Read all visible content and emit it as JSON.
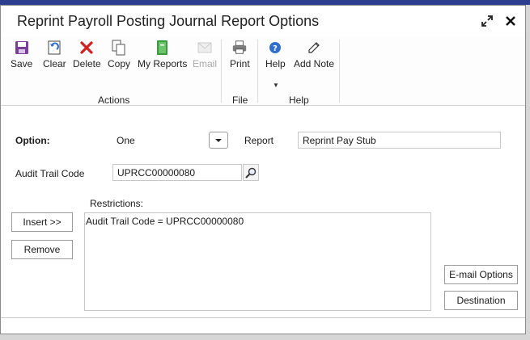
{
  "window": {
    "title": "Reprint Payroll Posting Journal Report Options"
  },
  "ribbon": {
    "actions": {
      "group_label": "Actions",
      "save": "Save",
      "clear": "Clear",
      "delete": "Delete",
      "copy": "Copy",
      "my_reports": "My Reports",
      "email": "Email"
    },
    "file": {
      "group_label": "File",
      "print": "Print"
    },
    "help": {
      "group_label": "Help",
      "help": "Help",
      "add_note": "Add Note"
    }
  },
  "form": {
    "option_label": "Option:",
    "option_value": "One",
    "report_label": "Report",
    "report_value": "Reprint Pay Stub",
    "audit_trail_label": "Audit Trail Code",
    "audit_trail_value": "UPRCC00000080",
    "restrictions_label": "Restrictions:",
    "restrictions": [
      "Audit Trail Code = UPRCC00000080"
    ]
  },
  "buttons": {
    "insert": "Insert >>",
    "remove": "Remove",
    "email_options": "E-mail Options",
    "destination": "Destination"
  },
  "icons": {
    "save": "floppy-disk-icon",
    "clear": "undo-icon",
    "delete": "red-x-icon",
    "copy": "copy-pages-icon",
    "my_reports": "green-book-icon",
    "email": "envelope-icon",
    "print": "printer-icon",
    "help": "question-circle-icon",
    "add_note": "note-pencil-icon",
    "expand": "expand-arrows-icon",
    "close": "close-icon",
    "combo": "chevron-down-icon",
    "lookup": "magnifier-icon"
  },
  "colors": {
    "topband": "#2b3f8e",
    "delete_red": "#d21f1f",
    "save_purple": "#7a3f9a",
    "help_blue": "#2f6fd0",
    "book_green": "#3b9a3b"
  }
}
